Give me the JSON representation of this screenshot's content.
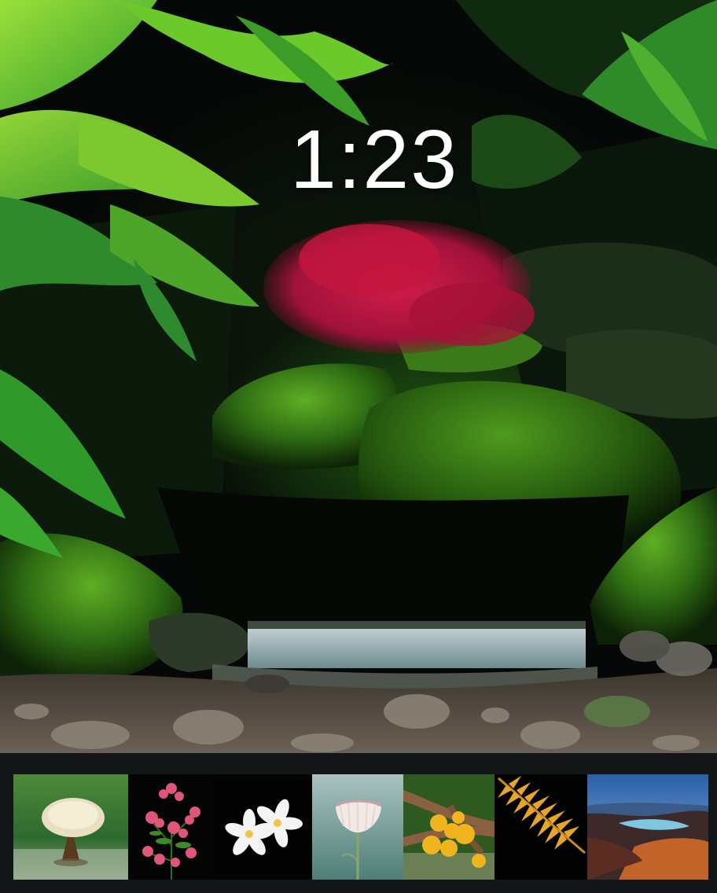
{
  "lock_screen": {
    "clock": "1:23"
  },
  "wallpaper": {
    "icon": "forest-waterfall-photo"
  },
  "gallery": {
    "thumbnails": [
      {
        "icon": "tree-in-water-photo"
      },
      {
        "icon": "pink-flower-shrub-photo"
      },
      {
        "icon": "white-flowers-photo"
      },
      {
        "icon": "dandelion-flower-photo"
      },
      {
        "icon": "yellow-mushrooms-photo"
      },
      {
        "icon": "golden-fern-photo"
      },
      {
        "icon": "coastal-landscape-photo"
      }
    ]
  },
  "colors": {
    "strip_background": "#131617",
    "clock_text": "#ffffff",
    "moss": "#3f8a1e",
    "maple_red": "#b3143d"
  }
}
